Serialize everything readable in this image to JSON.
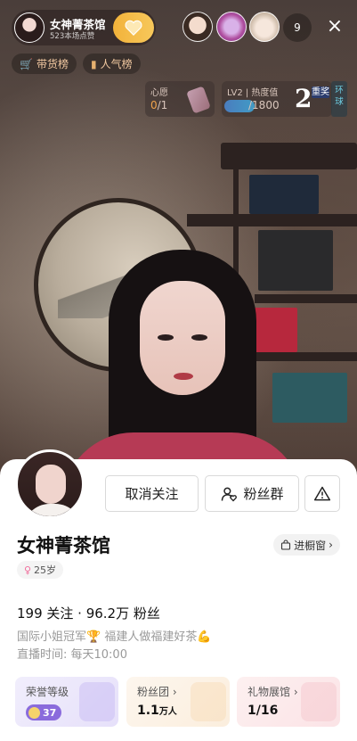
{
  "top_bar": {
    "host_name": "女神菁茶馆",
    "host_sub": "523本场点赞",
    "viewer_count": "9",
    "close_icon": "×"
  },
  "ranks": {
    "goods_rank": "带货榜",
    "popularity_rank": "人气榜"
  },
  "live_widgets": {
    "task_title": "心愿",
    "task_done": "0",
    "task_total": "/1",
    "heat_title": "LV2 | 热度值",
    "heat_progress": "/1800",
    "prize_big": "2",
    "prize_sub": "重奖",
    "ring_tag": "环球"
  },
  "profile": {
    "unfollow_label": "取消关注",
    "fan_group_label": "粉丝群",
    "name": "女神菁茶馆",
    "showcase_label": "进橱窗",
    "age": "25岁",
    "stats": "199 关注 · 96.2万 粉丝",
    "bio_line1": "国际小姐冠军🏆 福建人做福建好茶💪",
    "bio_line2": "直播时间: 每天10:00"
  },
  "cards": [
    {
      "label": "荣誉等级",
      "value": "37"
    },
    {
      "label": "粉丝团 ›",
      "value": "1.1",
      "unit": "万人"
    },
    {
      "label": "礼物展馆 ›",
      "value": "1/16"
    }
  ],
  "colors": {
    "accent_gold": "#f2b23a",
    "level_purple": "#8a6bdc",
    "heat_orange": "#f0a34b"
  }
}
